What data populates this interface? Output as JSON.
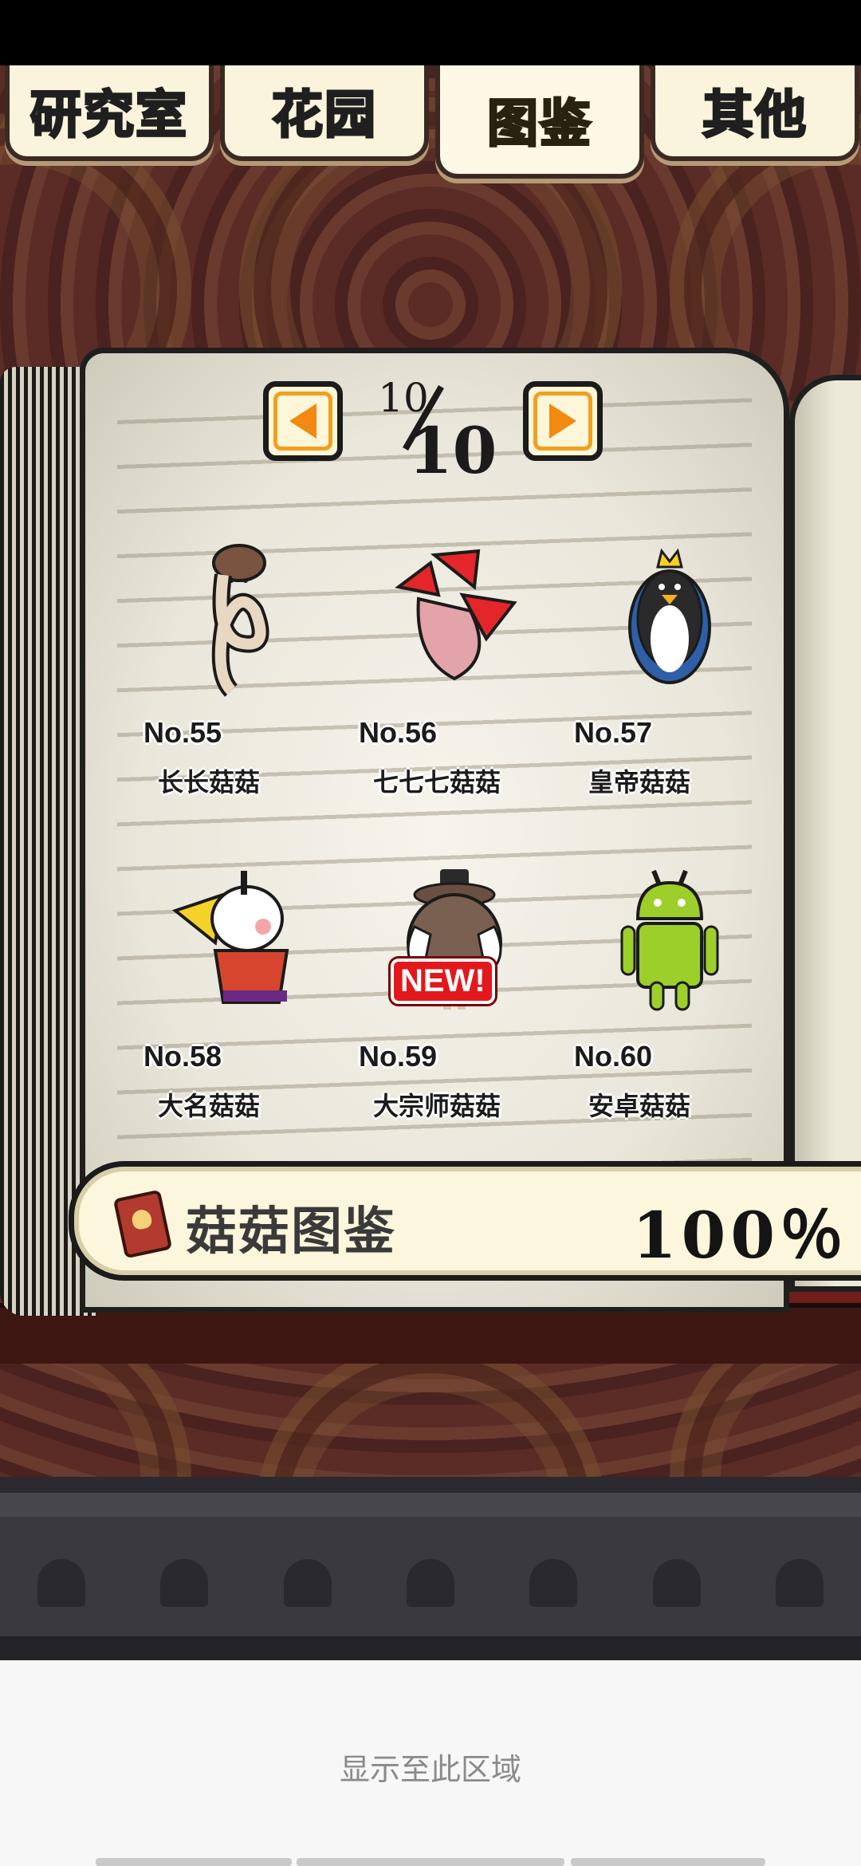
{
  "tabs": [
    {
      "label": "研究室",
      "active": false
    },
    {
      "label": "花园",
      "active": false
    },
    {
      "label": "图鉴",
      "active": true
    },
    {
      "label": "其他",
      "active": false
    }
  ],
  "pager": {
    "current": "10",
    "total": "10",
    "prev_icon": "arrow-left-icon",
    "next_icon": "arrow-right-icon"
  },
  "entries": [
    {
      "no": "No.55",
      "name": "长长菇菇",
      "new": false
    },
    {
      "no": "No.56",
      "name": "七七七菇菇",
      "new": false
    },
    {
      "no": "No.57",
      "name": "皇帝菇菇",
      "new": false
    },
    {
      "no": "No.58",
      "name": "大名菇菇",
      "new": false
    },
    {
      "no": "No.59",
      "name": "大宗师菇菇",
      "new": true,
      "badge": "NEW!"
    },
    {
      "no": "No.60",
      "name": "安卓菇菇",
      "new": false
    }
  ],
  "progress": {
    "title": "菇菇图鉴",
    "value": "100％",
    "icon": "book-icon"
  },
  "footer": {
    "label": "显示至此区域"
  },
  "colors": {
    "tab_active_text": "#ffd21a",
    "arrow": "#f28a10",
    "new_badge": "#e3181c",
    "background": "#5a2a24"
  }
}
